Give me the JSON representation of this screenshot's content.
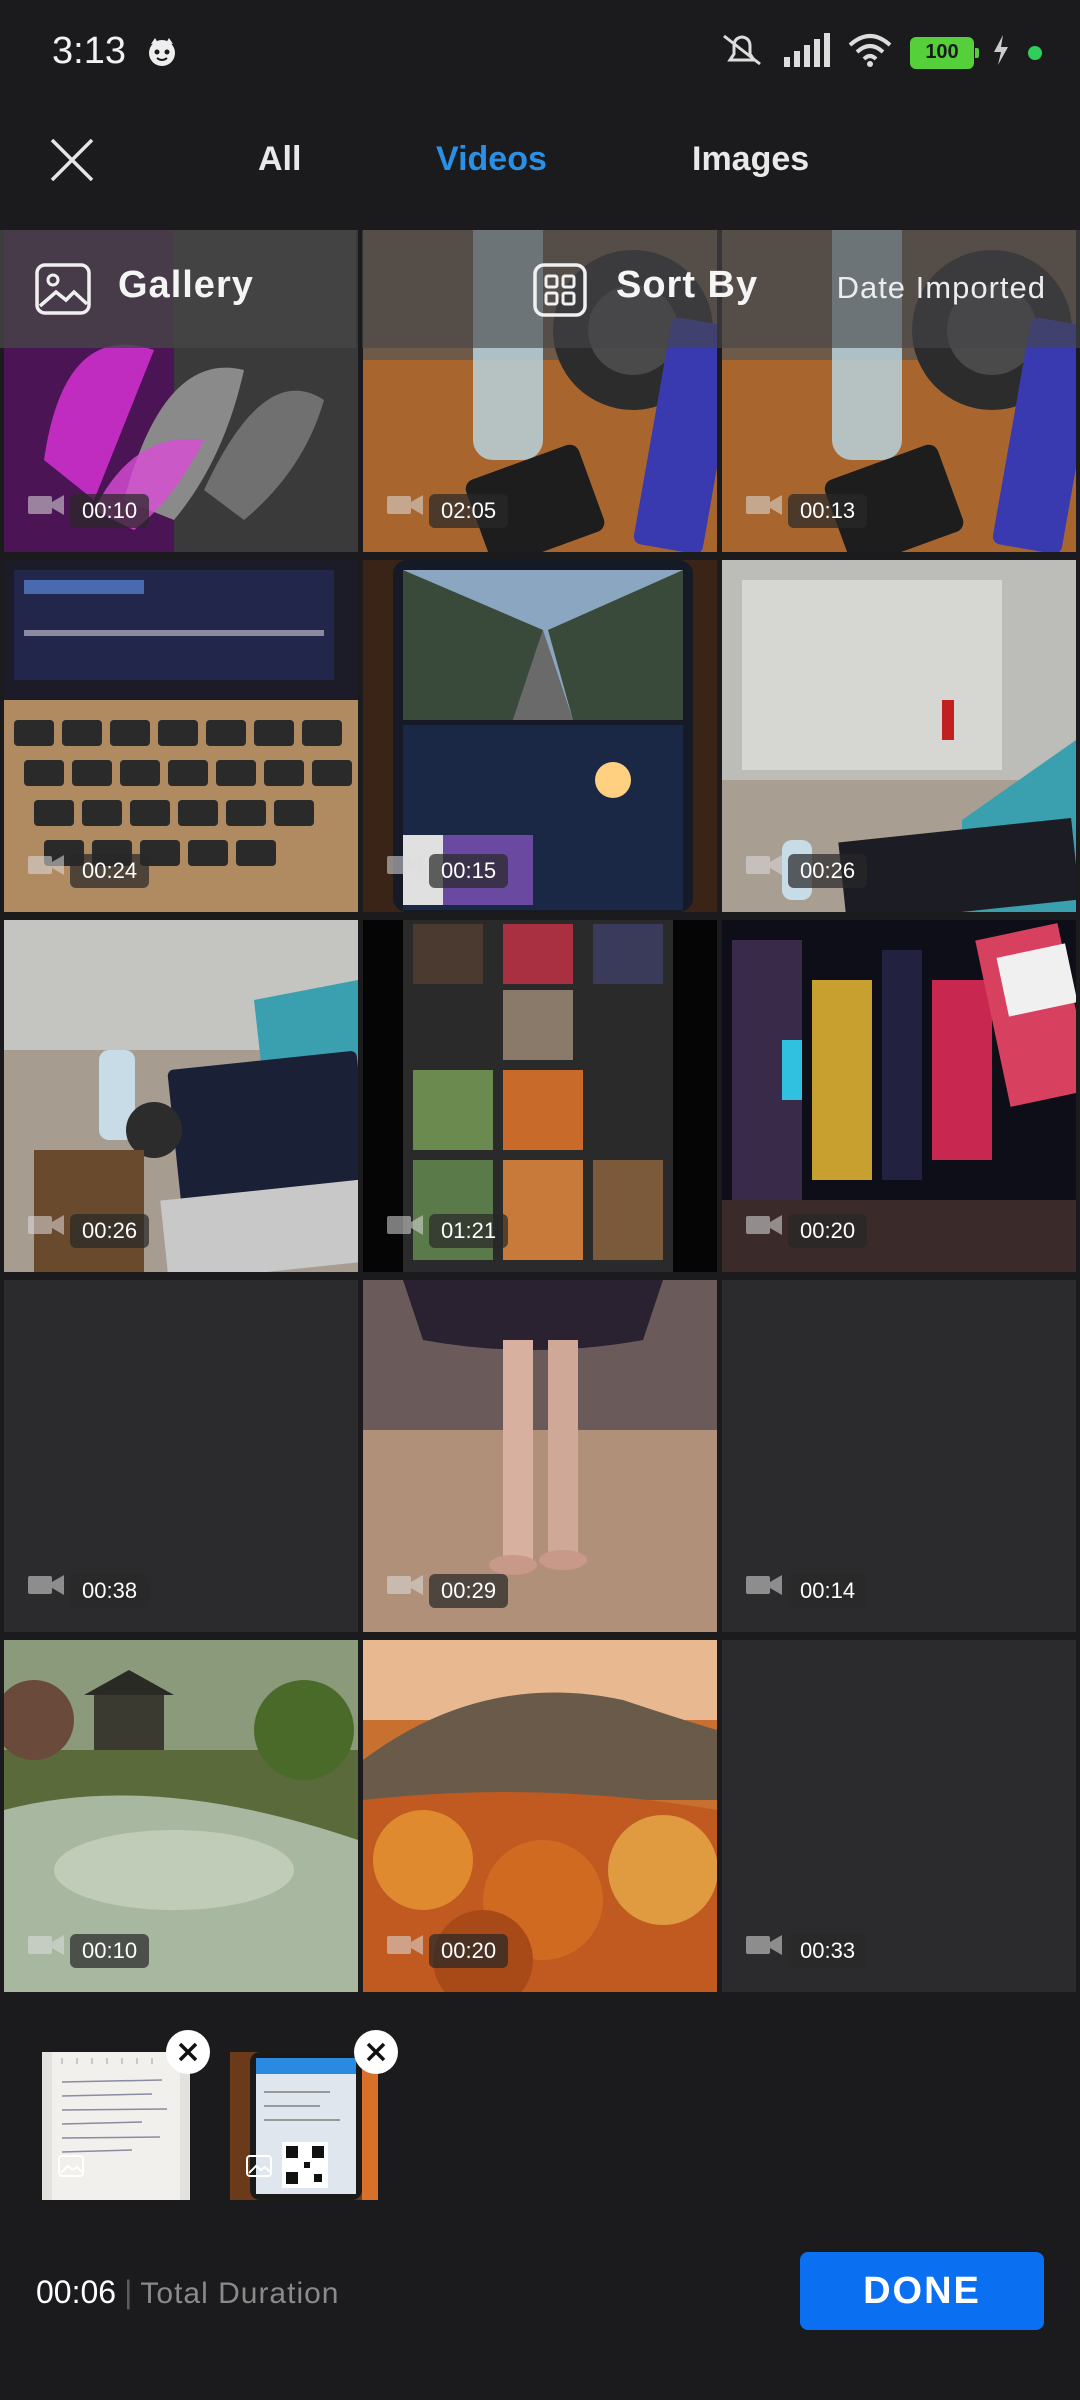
{
  "status_bar": {
    "time": "3:13",
    "battery": "100"
  },
  "header": {
    "tabs": [
      {
        "label": "All"
      },
      {
        "label": "Videos"
      },
      {
        "label": "Images"
      }
    ],
    "active_tab": "Videos"
  },
  "gallery_bar": {
    "gallery_label": "Gallery",
    "sort_label": "Sort By",
    "sort_value": "Date Imported"
  },
  "media": [
    {
      "duration": "00:10",
      "scene": "purple flower"
    },
    {
      "duration": "02:05",
      "scene": "desk with bottle"
    },
    {
      "duration": "00:13",
      "scene": "desk with bottle"
    },
    {
      "duration": "00:24",
      "scene": "laptop keyboard"
    },
    {
      "duration": "00:15",
      "scene": "phone showing road"
    },
    {
      "duration": "00:26",
      "scene": "office glass wall"
    },
    {
      "duration": "00:26",
      "scene": "desk with laptop"
    },
    {
      "duration": "01:21",
      "scene": "collage"
    },
    {
      "duration": "00:20",
      "scene": "city at night"
    },
    {
      "duration": "00:38",
      "scene": "blank"
    },
    {
      "duration": "00:29",
      "scene": "beach walking"
    },
    {
      "duration": "00:14",
      "scene": "blank"
    },
    {
      "duration": "00:10",
      "scene": "garden pond"
    },
    {
      "duration": "00:20",
      "scene": "autumn forest"
    },
    {
      "duration": "00:33",
      "scene": "blank"
    }
  ],
  "selected": [
    {
      "type": "image",
      "scene": "notebook page"
    },
    {
      "type": "image",
      "scene": "phone with qr code"
    }
  ],
  "footer": {
    "total_duration": "00:06",
    "total_label": "Total Duration",
    "done_label": "DONE"
  },
  "colors": {
    "background": "#1b1b1d",
    "accent": "#2a90e6",
    "done_button": "#0a6ff0",
    "battery": "#56d03a"
  },
  "icons": [
    "close-icon",
    "gallery-image-icon",
    "sort-grid-icon",
    "video-camera-icon",
    "image-icon",
    "remove-x-icon"
  ]
}
